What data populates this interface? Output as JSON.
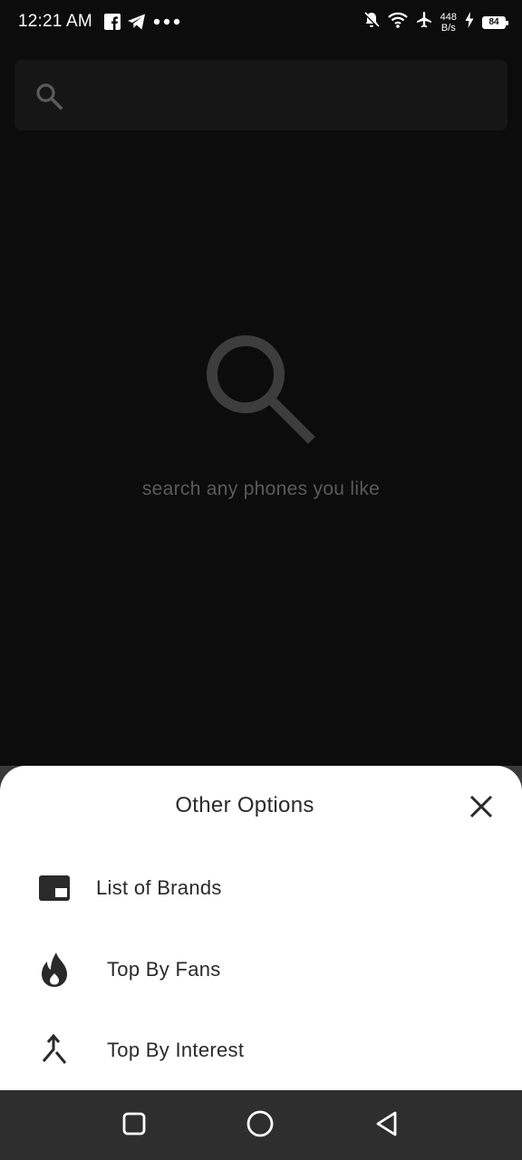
{
  "status_bar": {
    "time": "12:21 AM",
    "net_speed_value": "448",
    "net_speed_unit": "B/s",
    "battery_level": "84",
    "left_icons": [
      "facebook-icon",
      "telegram-icon",
      "more-dots-icon"
    ],
    "right_icons": [
      "bell-off-icon",
      "wifi-icon",
      "airplane-icon",
      "charging-icon"
    ]
  },
  "search": {
    "placeholder": "",
    "value": ""
  },
  "empty_state": {
    "icon": "search-icon",
    "message": "search any phones you like"
  },
  "sheet": {
    "title": "Other Options",
    "close_icon": "close-icon",
    "options": [
      {
        "label": "List of Brands",
        "icon": "picture-in-picture-icon"
      },
      {
        "label": "Top By Fans",
        "icon": "flame-icon"
      },
      {
        "label": "Top By Interest",
        "icon": "merge-arrow-icon"
      }
    ]
  },
  "nav_bar": {
    "buttons": [
      "recents-square-icon",
      "home-circle-icon",
      "back-triangle-icon"
    ]
  },
  "colors": {
    "background": "#0c0c0c",
    "search_bar": "#161616",
    "empty_text": "#5a5a5a",
    "sheet": "#ffffff",
    "sheet_text": "#2a2a2a",
    "nav_bar": "#2e2e2e"
  }
}
